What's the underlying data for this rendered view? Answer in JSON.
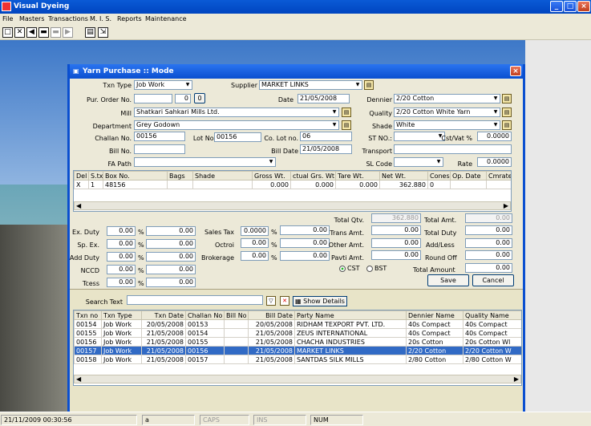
{
  "app": {
    "title": "Visual Dyeing"
  },
  "menu": [
    "File",
    "Masters",
    "Transactions",
    "M. I. S.",
    "Reports",
    "Maintenance"
  ],
  "toolbar_icons": [
    "new-icon",
    "delete-icon",
    "first-icon",
    "prev-icon",
    "next-icon",
    "last-icon",
    "print-icon",
    "exit-icon"
  ],
  "dialog": {
    "title": "Yarn Purchase :: Mode"
  },
  "form": {
    "txn_type_label": "Txn Type",
    "txn_type": "Job Work",
    "supplier_label": "Supplier",
    "supplier": "MARKET LINKS",
    "pur_order_label": "Pur. Order No.",
    "pur_order_2": "0",
    "pur_order_btn": "0",
    "date_label": "Date",
    "date": "21/05/2008",
    "dennier_label": "Dennier",
    "dennier": "2/20 Cotton",
    "mill_label": "Mill",
    "mill": "Shatkari Sahkari Mills Ltd.",
    "quality_label": "Quality",
    "quality": "2/20 Cotton White Yarn",
    "department_label": "Department",
    "department": "Grey Godown",
    "shade_label": "Shade",
    "shade": "White",
    "challan_label": "Challan No.",
    "challan": "00156",
    "lot_label": "Lot No.",
    "lot": "00156",
    "colot_label": "Co. Lot no.",
    "colot": "06",
    "stno_label": "ST NO.:",
    "cstvat_label": "Cst/Vat %",
    "cstvat": "0.0000",
    "billno_label": "Bill No.",
    "billdate_label": "Bill Date",
    "billdate": "21/05/2008",
    "transport_label": "Transport",
    "fapath_label": "FA Path",
    "slcode_label": "SL Code",
    "rate_label": "Rate",
    "rate": "0.0000"
  },
  "detail_grid": {
    "headers": [
      "Del",
      "S.txt",
      "Box No.",
      "Bags",
      "Shade",
      "Gross Wt.",
      "ctual Grs. Wt.",
      "Tare Wt.",
      "Net Wt.",
      "Cones",
      "Op. Date",
      "Cmrate"
    ],
    "rows": [
      [
        "X",
        "1",
        "48156",
        "",
        "",
        "0.000",
        "0.000",
        "0.000",
        "362.880",
        "0",
        "",
        ""
      ]
    ]
  },
  "duties": {
    "ex_duty": {
      "label": "Ex. Duty",
      "pct": "0.00",
      "amt": "0.00"
    },
    "sp_ex": {
      "label": "Sp. Ex.",
      "pct": "0.00",
      "amt": "0.00"
    },
    "add_duty": {
      "label": "Add Duty",
      "pct": "0.00",
      "amt": "0.00"
    },
    "nccd": {
      "label": "NCCD",
      "pct": "0.00",
      "amt": "0.00"
    },
    "tcess": {
      "label": "Tcess",
      "pct": "0.00",
      "amt": "0.00"
    },
    "pct_sign": "%",
    "sales_tax": {
      "label": "Sales Tax",
      "pct": "0.0000",
      "amt": "0.00"
    },
    "octroi": {
      "label": "Octroi",
      "pct": "0.00",
      "amt": "0.00"
    },
    "brokerage": {
      "label": "Brokerage",
      "pct": "0.00",
      "amt": "0.00"
    }
  },
  "totals": {
    "total_qty_label": "Total Qtv.",
    "total_qty": "362.880",
    "trans_amt_label": "Trans Amt.",
    "trans_amt": "0.00",
    "other_amt_label": "Other Amt.",
    "other_amt": "0.00",
    "pavti_amt_label": "Pavti Amt.",
    "pavti_amt": "0.00",
    "total_amt_label": "Total Amt.",
    "total_amt": "0.00",
    "total_duty_label": "Total Duty",
    "total_duty": "0.00",
    "add_less_label": "Add/Less",
    "add_less": "0.00",
    "round_off_label": "Round Off",
    "round_off": "0.00",
    "total_amount_label": "Total Amount",
    "total_amount": "0.00",
    "cst_label": "CST",
    "bst_label": "BST"
  },
  "buttons": {
    "save": "Save",
    "cancel": "Cancel",
    "show_details": "Show Details"
  },
  "search": {
    "label": "Search Text",
    "value": ""
  },
  "list_grid": {
    "headers": [
      "Txn no",
      "Txn Type",
      "Txn Date",
      "Challan No",
      "Bill No",
      "Bill Date",
      "Party Name",
      "Dennier Name",
      "Quality Name"
    ],
    "rows": [
      [
        "00154",
        "Job Work",
        "20/05/2008",
        "00153",
        "",
        "20/05/2008",
        "RIDHAM TEXPORT PVT. LTD.",
        "40s Compact",
        "40s Compact"
      ],
      [
        "00155",
        "Job Work",
        "21/05/2008",
        "00154",
        "",
        "21/05/2008",
        "ZEUS INTERNATIONAL",
        "40s Compact",
        "40s Compact"
      ],
      [
        "00156",
        "Job Work",
        "21/05/2008",
        "00155",
        "",
        "21/05/2008",
        "CHACHA INDUSTRIES",
        "20s Cotton",
        "20s Cotton Wl"
      ],
      [
        "00157",
        "Job Work",
        "21/05/2008",
        "00156",
        "",
        "21/05/2008",
        "MARKET LINKS",
        "2/20 Cotton",
        "2/20 Cotton W"
      ],
      [
        "00158",
        "Job Work",
        "21/05/2008",
        "00157",
        "",
        "21/05/2008",
        "SANTDAS SILK MILLS",
        "2/80 Cotton",
        "2/80 Cotton W"
      ]
    ],
    "selected": 3
  },
  "status": {
    "datetime": "21/11/2009 00:30:56",
    "a": "a",
    "caps": "CAPS",
    "ins": "INS",
    "num": "NUM"
  },
  "colors": {
    "titlebar": "#0a5ad6",
    "selection": "#316ac5",
    "dialog_bg": "#ece9d8"
  }
}
